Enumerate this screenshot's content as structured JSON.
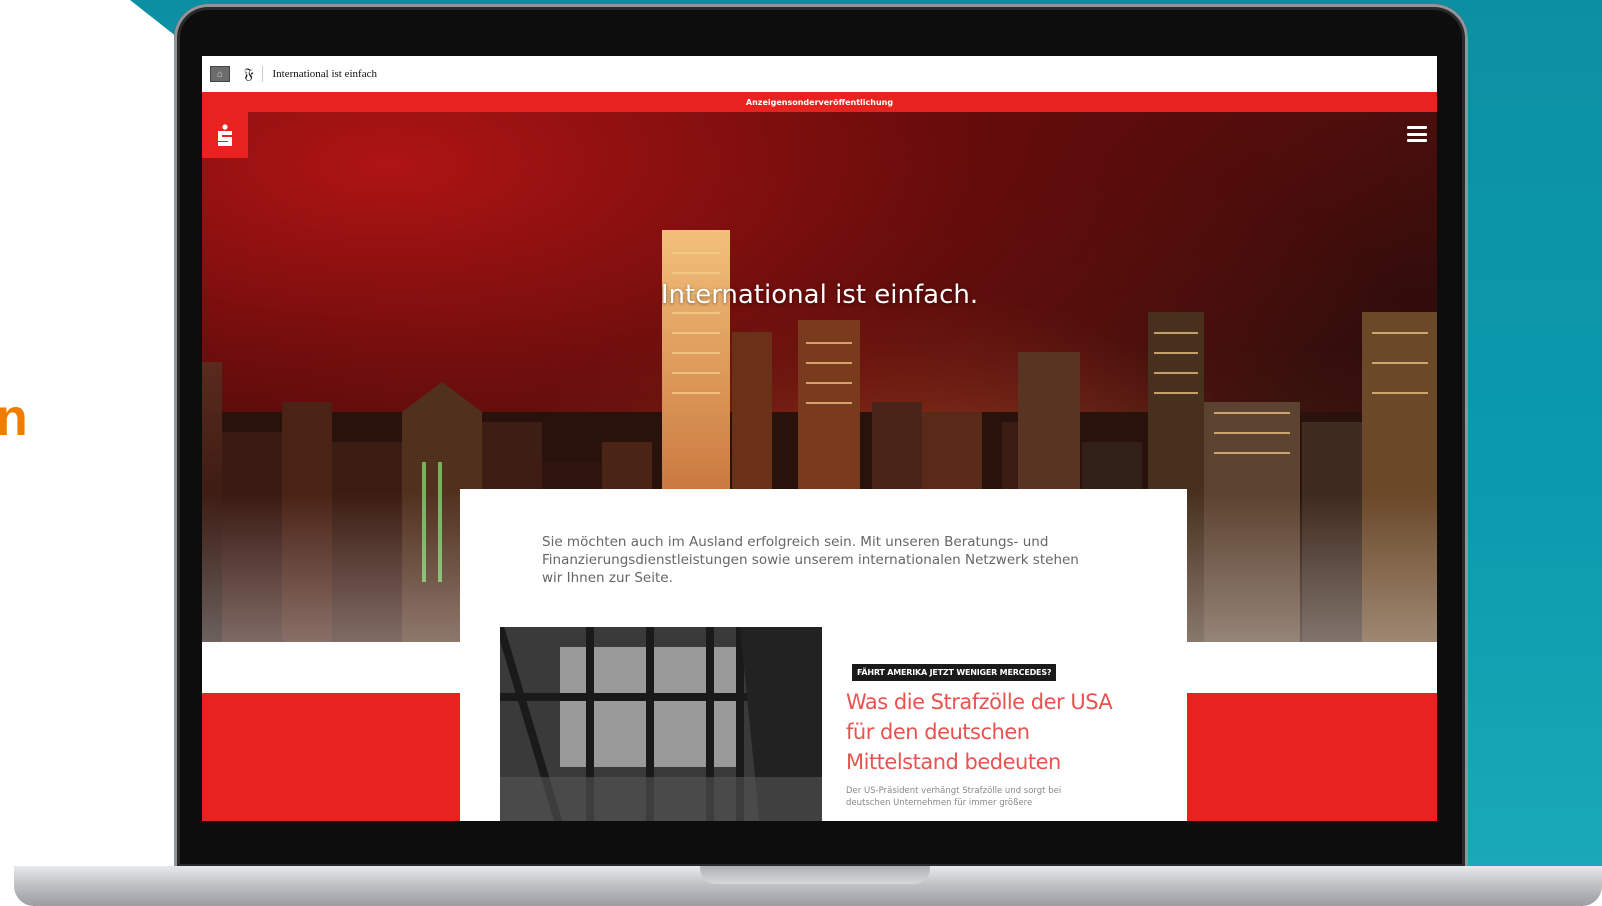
{
  "side_text": "n",
  "browser": {
    "header_title": "International ist einfach",
    "home_icon": "home-icon",
    "logo_icon": "faz-logo-icon"
  },
  "ad_banner": "Anzeigensonderveröffentlichung",
  "hero": {
    "title": "International ist einfach.",
    "menu_icon": "hamburger-menu-icon",
    "brand_icon": "sparkasse-logo-icon"
  },
  "intro": "Sie möchten auch im Ausland erfolgreich sein. Mit unseren Beratungs- und Finanzierungsdienstleistungen sowie unserem internationalen Netzwerk stehen wir Ihnen zur Seite.",
  "article": {
    "tag": "FÄHRT AMERIKA JETZT WENIGER MERCEDES?",
    "title": "Was die Strafzölle der USA für den deutschen Mittelstand bedeuten",
    "excerpt": "Der US-Präsident verhängt Strafzölle und sorgt bei deutschen Unternehmen für immer größere"
  },
  "colors": {
    "brand_red": "#e8221e",
    "teal": "#0d8fa3",
    "article_title": "#e8534f"
  }
}
